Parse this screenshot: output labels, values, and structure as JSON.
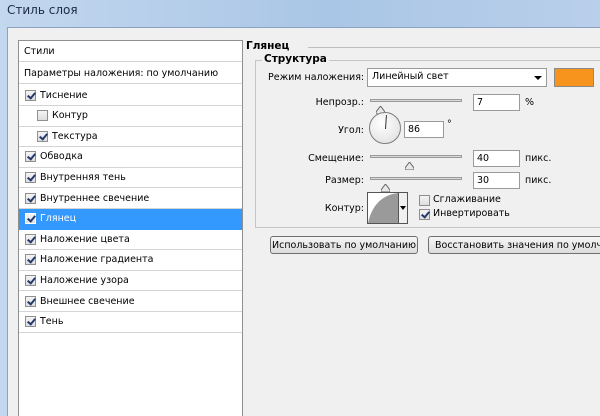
{
  "window": {
    "title": "Стиль слоя"
  },
  "styles_list": {
    "header": "Стили",
    "blending_defaults": "Параметры наложения: по умолчанию",
    "items": [
      {
        "label": "Тиснение",
        "checked": true,
        "indent": false
      },
      {
        "label": "Контур",
        "checked": false,
        "indent": true
      },
      {
        "label": "Текстура",
        "checked": true,
        "indent": true
      },
      {
        "label": "Обводка",
        "checked": true,
        "indent": false
      },
      {
        "label": "Внутренняя тень",
        "checked": true,
        "indent": false
      },
      {
        "label": "Внутреннее свечение",
        "checked": true,
        "indent": false
      },
      {
        "label": "Глянец",
        "checked": true,
        "indent": false,
        "selected": true
      },
      {
        "label": "Наложение цвета",
        "checked": true,
        "indent": false
      },
      {
        "label": "Наложение градиента",
        "checked": true,
        "indent": false
      },
      {
        "label": "Наложение узора",
        "checked": true,
        "indent": false
      },
      {
        "label": "Внешнее свечение",
        "checked": true,
        "indent": false
      },
      {
        "label": "Тень",
        "checked": true,
        "indent": false
      }
    ]
  },
  "satin": {
    "title": "Глянец",
    "structure_title": "Структура",
    "blend_mode": {
      "label": "Режим наложения:",
      "value": "Линейный свет",
      "color": "#f7941d"
    },
    "opacity": {
      "label": "Непрозр.:",
      "value": "7",
      "unit": "%",
      "fraction": 0.07
    },
    "angle": {
      "label": "Угол:",
      "value": "86",
      "unit": "°"
    },
    "distance": {
      "label": "Смещение:",
      "value": "40",
      "unit": "пикс.",
      "fraction": 0.4
    },
    "size": {
      "label": "Размер:",
      "value": "30",
      "unit": "пикс.",
      "fraction": 0.12
    },
    "contour": {
      "label": "Контур:"
    },
    "antialias": {
      "label": "Сглаживание",
      "checked": false
    },
    "invert": {
      "label": "Инвертировать",
      "checked": true
    }
  },
  "buttons": {
    "make_default": "Использовать по умолчанию",
    "reset_default": "Восстановить значения по умолчанию"
  }
}
